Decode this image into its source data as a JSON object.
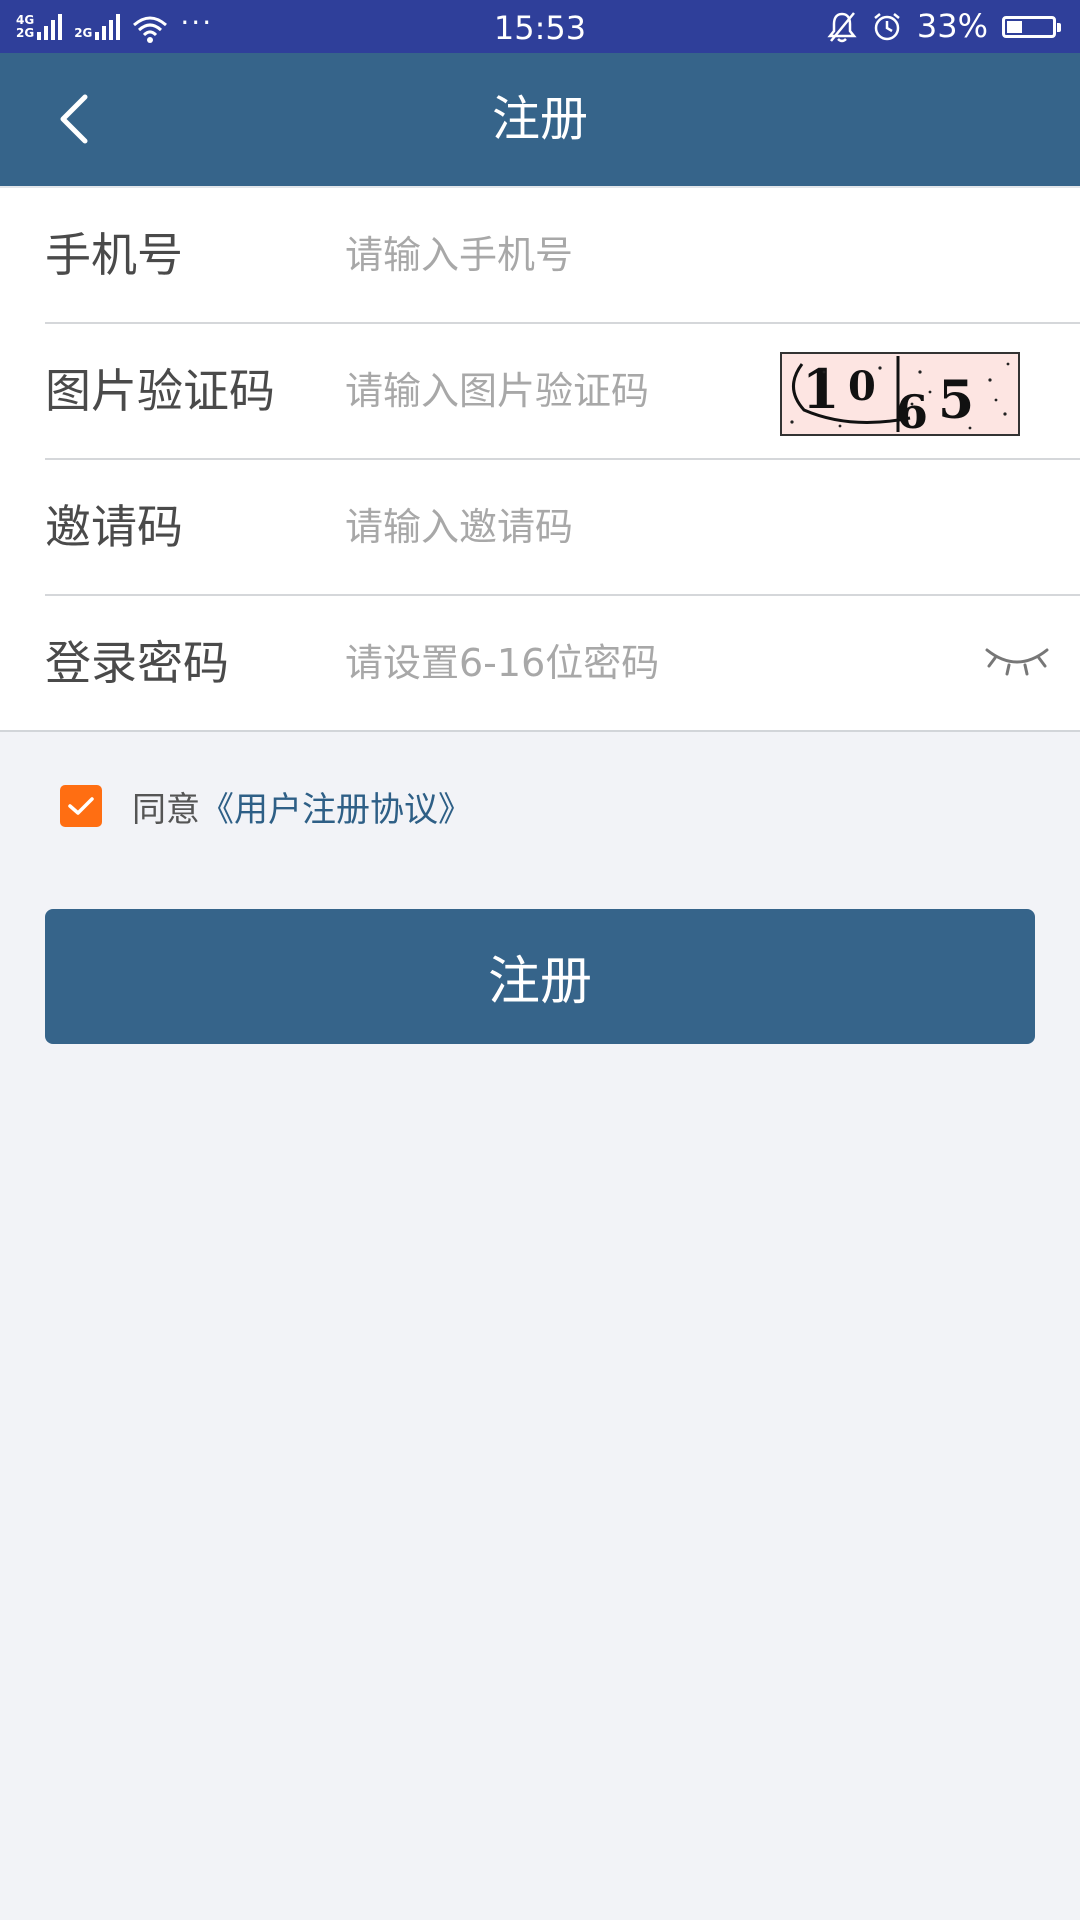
{
  "status_bar": {
    "network_primary": "4G",
    "network_secondary_top": "2G",
    "network_secondary_bottom": "2G",
    "more": "···",
    "time": "15:53",
    "battery_percent": "33%",
    "battery_level": 0.33
  },
  "header": {
    "title": "注册"
  },
  "form": {
    "rows": [
      {
        "label": "手机号",
        "placeholder": "请输入手机号"
      },
      {
        "label": "图片验证码",
        "placeholder": "请输入图片验证码",
        "captcha_text": "1065"
      },
      {
        "label": "邀请码",
        "placeholder": "请输入邀请码"
      },
      {
        "label": "登录密码",
        "placeholder": "请设置6-16位密码"
      }
    ]
  },
  "agreement": {
    "checked": true,
    "prefix": "同意",
    "link_text": "《用户注册协议》"
  },
  "submit": {
    "label": "注册"
  },
  "colors": {
    "status_bar": "#2f3f9a",
    "header": "#36648a",
    "checkbox": "#ff6e12",
    "link": "#2e5f86",
    "background": "#f2f3f7"
  }
}
